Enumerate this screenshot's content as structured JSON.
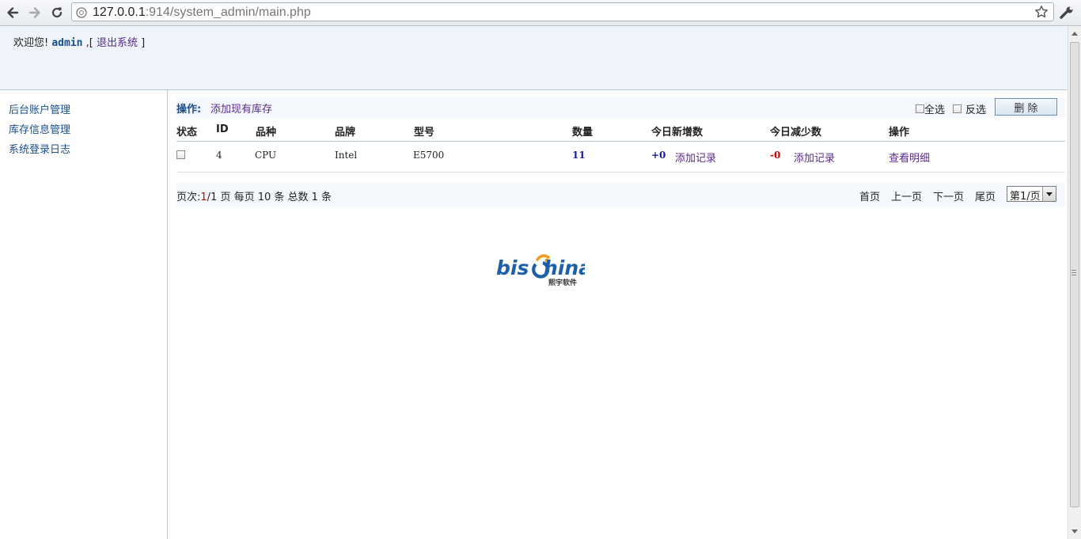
{
  "browser": {
    "url_host": "127.0.0.1",
    "url_rest": ":914/system_admin/main.php"
  },
  "header": {
    "welcome_prefix": "欢迎您!",
    "username": "admin",
    "separator": ",[",
    "logout_label": "退出系统",
    "close_bracket": "]"
  },
  "sidebar": {
    "items": [
      {
        "label": "后台账户管理"
      },
      {
        "label": "库存信息管理"
      },
      {
        "label": "系统登录日志"
      }
    ]
  },
  "operation": {
    "label": "操作:",
    "add_link": "添加现有库存",
    "select_all": "全选",
    "invert": "反选",
    "delete_label": "删 除"
  },
  "table": {
    "headers": [
      "状态",
      "ID",
      "品种",
      "品牌",
      "型号",
      "数量",
      "今日新增数",
      "今日减少数",
      "操作"
    ],
    "rows": [
      {
        "id": "4",
        "category": "CPU",
        "brand": "Intel",
        "model": "E5700",
        "qty": "11",
        "added": "+0",
        "add_record": "添加记录",
        "reduced": "-0",
        "reduce_record": "添加记录",
        "detail": "查看明细"
      }
    ]
  },
  "pager": {
    "prefix": "页次:",
    "current": "1",
    "rest": "/1 页 每页 10 条 总数 1 条",
    "first": "首页",
    "prev": "上一页",
    "next": "下一页",
    "last": "尾页",
    "select_value": "第1/页"
  },
  "logo": {
    "text_bis": "bis",
    "text_china": "hina",
    "subtitle": "熙宇软件"
  },
  "colors": {
    "header_bg": "#eef4fa",
    "link_blue": "#1a4f8b",
    "link_purple": "#5a2a8a",
    "logo_blue": "#1d5fa8",
    "logo_orange": "#f39a1e"
  }
}
